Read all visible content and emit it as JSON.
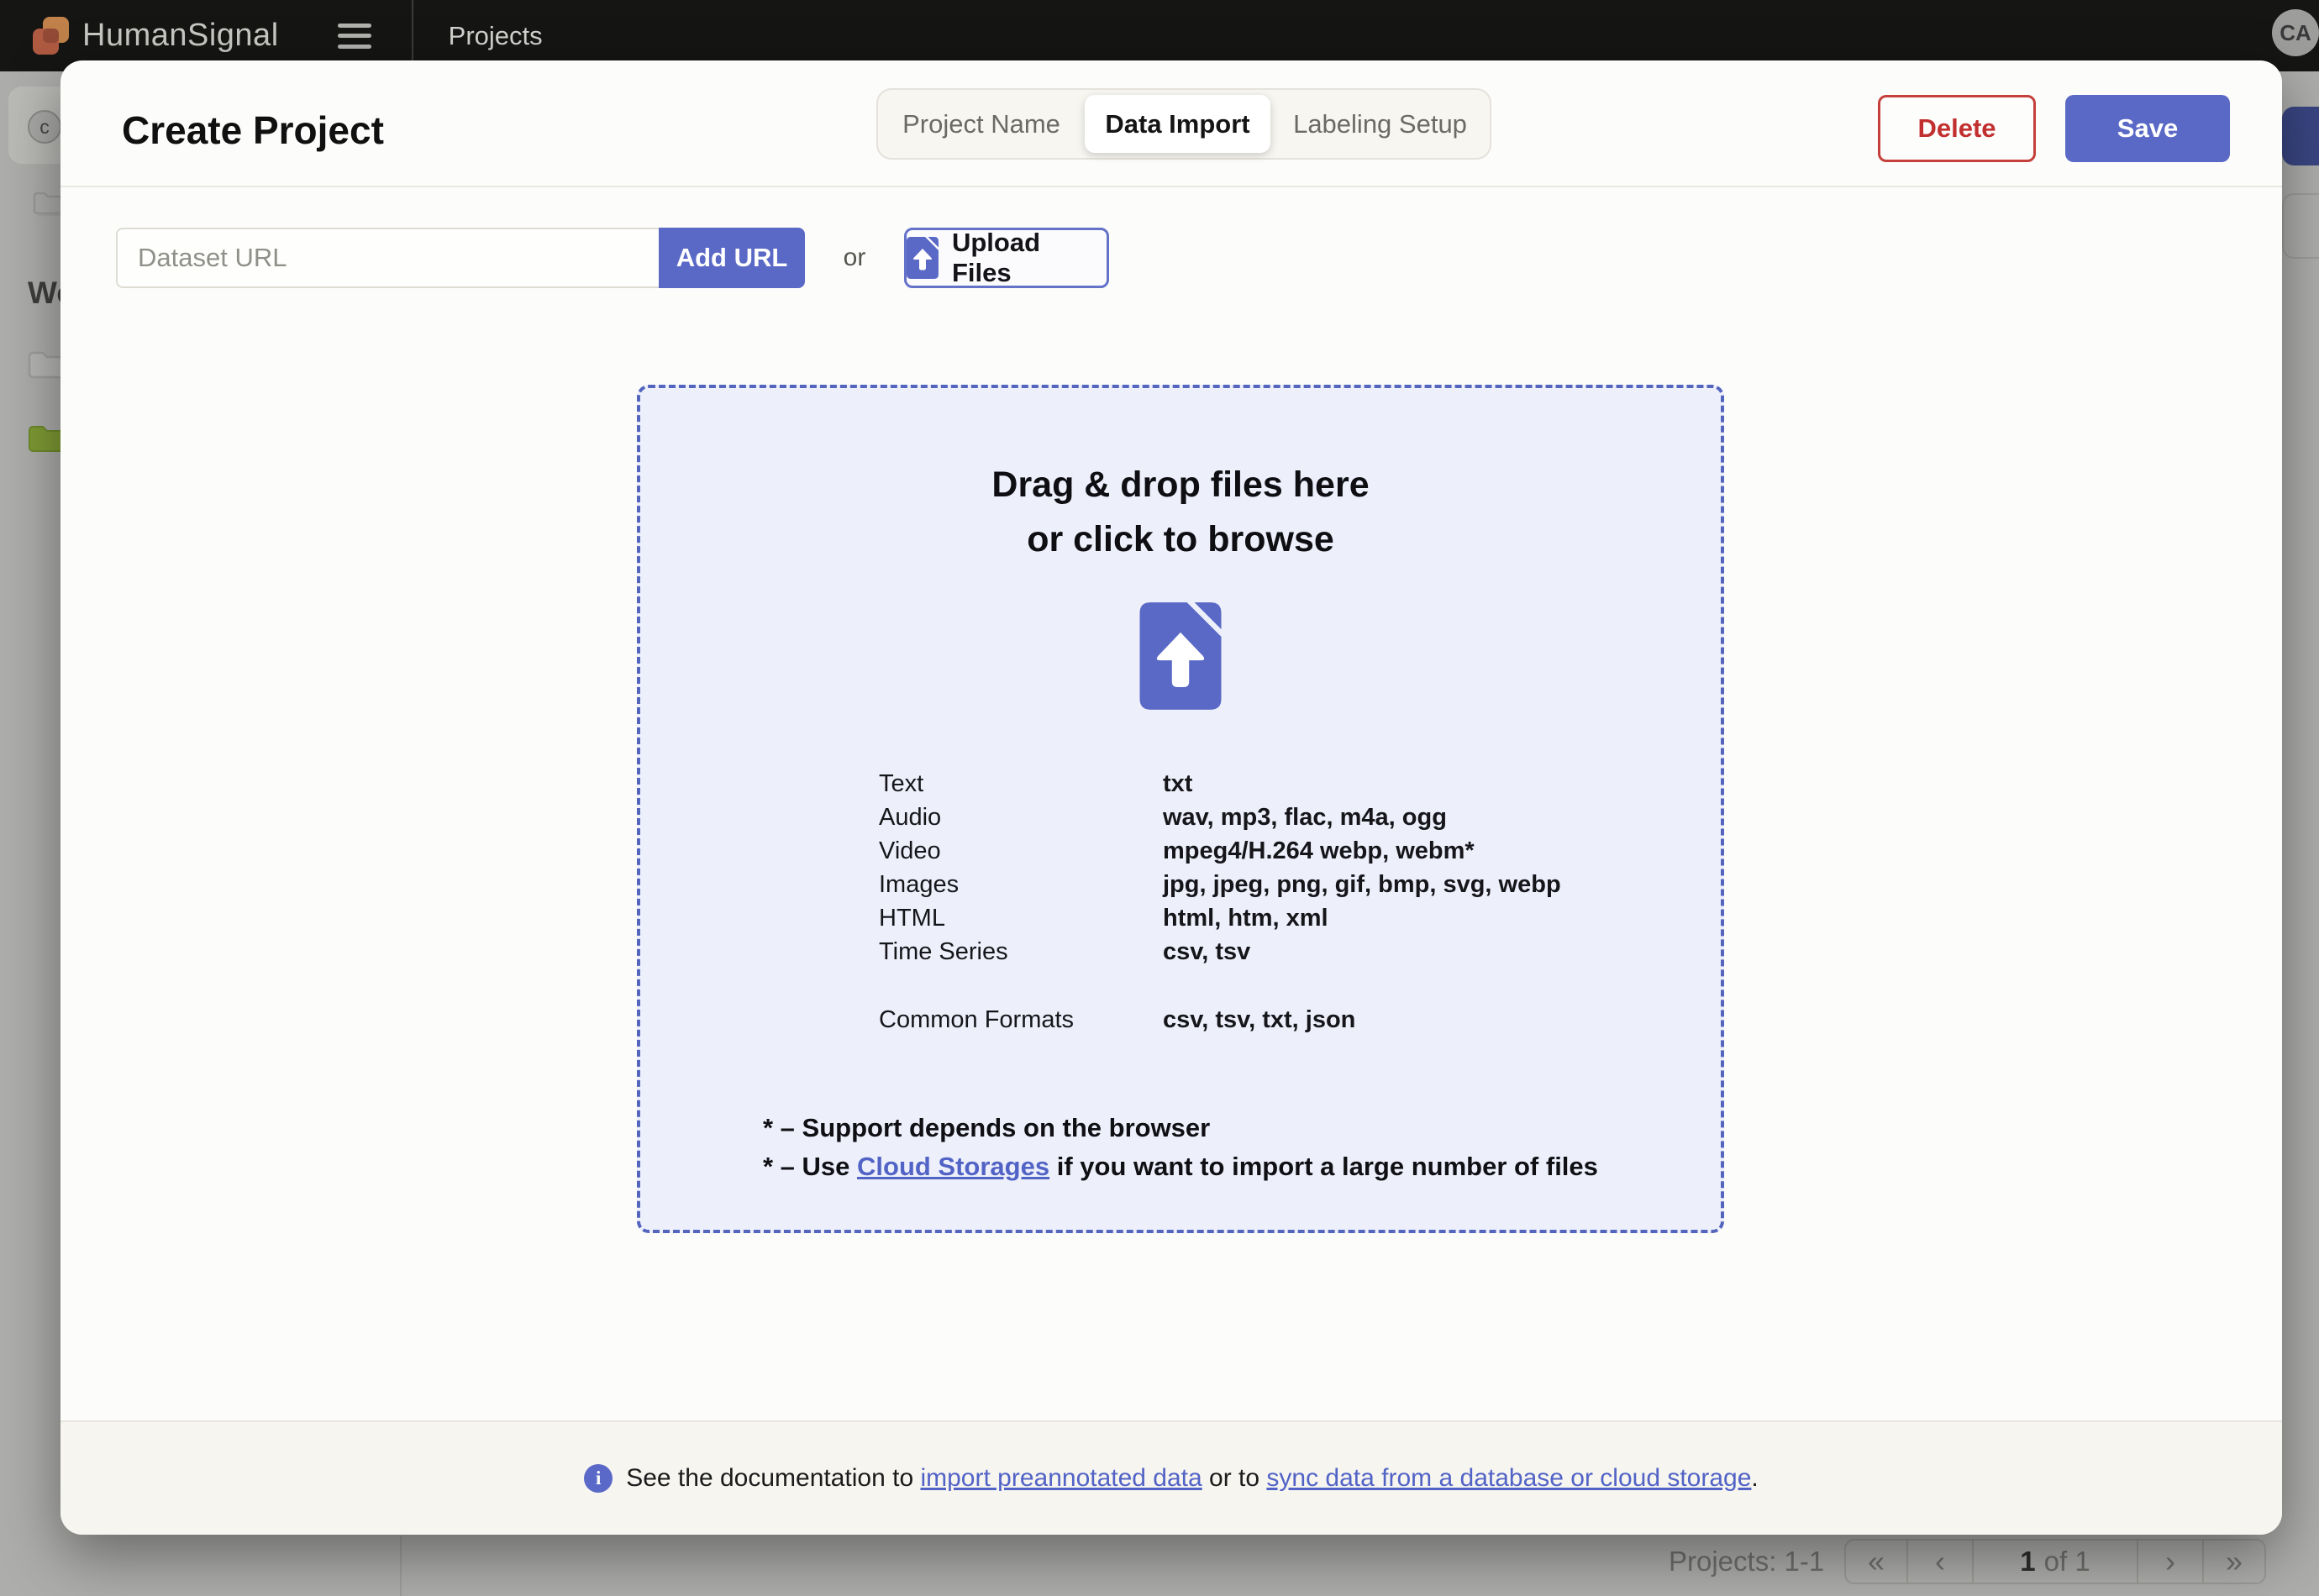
{
  "topbar": {
    "brand": "HumanSignal",
    "nav": "Projects",
    "avatar": "CA"
  },
  "background": {
    "sidebar_avatar": "c",
    "workspaces_partial": "Wo",
    "projects_range": "Projects: 1-1",
    "pagination": {
      "first": "«",
      "prev": "‹",
      "page": "1",
      "of_label": "of 1",
      "next": "›",
      "last": "»"
    }
  },
  "modal": {
    "title": "Create Project",
    "tabs": [
      {
        "label": "Project Name",
        "active": false
      },
      {
        "label": "Data Import",
        "active": true
      },
      {
        "label": "Labeling Setup",
        "active": false
      }
    ],
    "actions": {
      "delete": "Delete",
      "save": "Save"
    },
    "url_input": {
      "placeholder": "Dataset URL",
      "add_button": "Add URL",
      "separator": "or",
      "upload_button": "Upload Files"
    },
    "dropzone": {
      "heading_line1": "Drag & drop files here",
      "heading_line2": "or click to browse",
      "formats": [
        {
          "label": "Text",
          "value": "txt"
        },
        {
          "label": "Audio",
          "value": "wav, mp3, flac, m4a, ogg"
        },
        {
          "label": "Video",
          "value": "mpeg4/H.264 webp, webm*"
        },
        {
          "label": "Images",
          "value": "jpg, jpeg, png, gif, bmp, svg, webp"
        },
        {
          "label": "HTML",
          "value": "html, htm, xml"
        },
        {
          "label": "Time Series",
          "value": "csv, tsv"
        }
      ],
      "common_formats": {
        "label": "Common Formats",
        "value": "csv, tsv, txt, json"
      },
      "note_browser": "* – Support depends on the browser",
      "note_cloud_prefix": "* – Use ",
      "note_cloud_link": "Cloud Storages",
      "note_cloud_suffix": " if you want to import a large number of files"
    },
    "footer": {
      "prefix": "See the documentation to ",
      "link_import": "import preannotated data",
      "middle": " or to ",
      "link_sync": "sync data from a database or cloud storage",
      "suffix": "."
    }
  },
  "colors": {
    "accent_blue": "#5A69C6",
    "link_blue": "#5263C6",
    "delete_red": "#C22F2F",
    "dropzone_border": "#5465BE",
    "dropzone_bg": "#EDF0FB",
    "topbar_bg": "#151513",
    "modal_bg": "#FCFCFA",
    "footer_bg": "#F6F5F0",
    "backdrop": "#ADADAB",
    "brand_orange": "#C0824A",
    "brand_red": "#B05B42",
    "folder_green": "#7F9B34"
  }
}
